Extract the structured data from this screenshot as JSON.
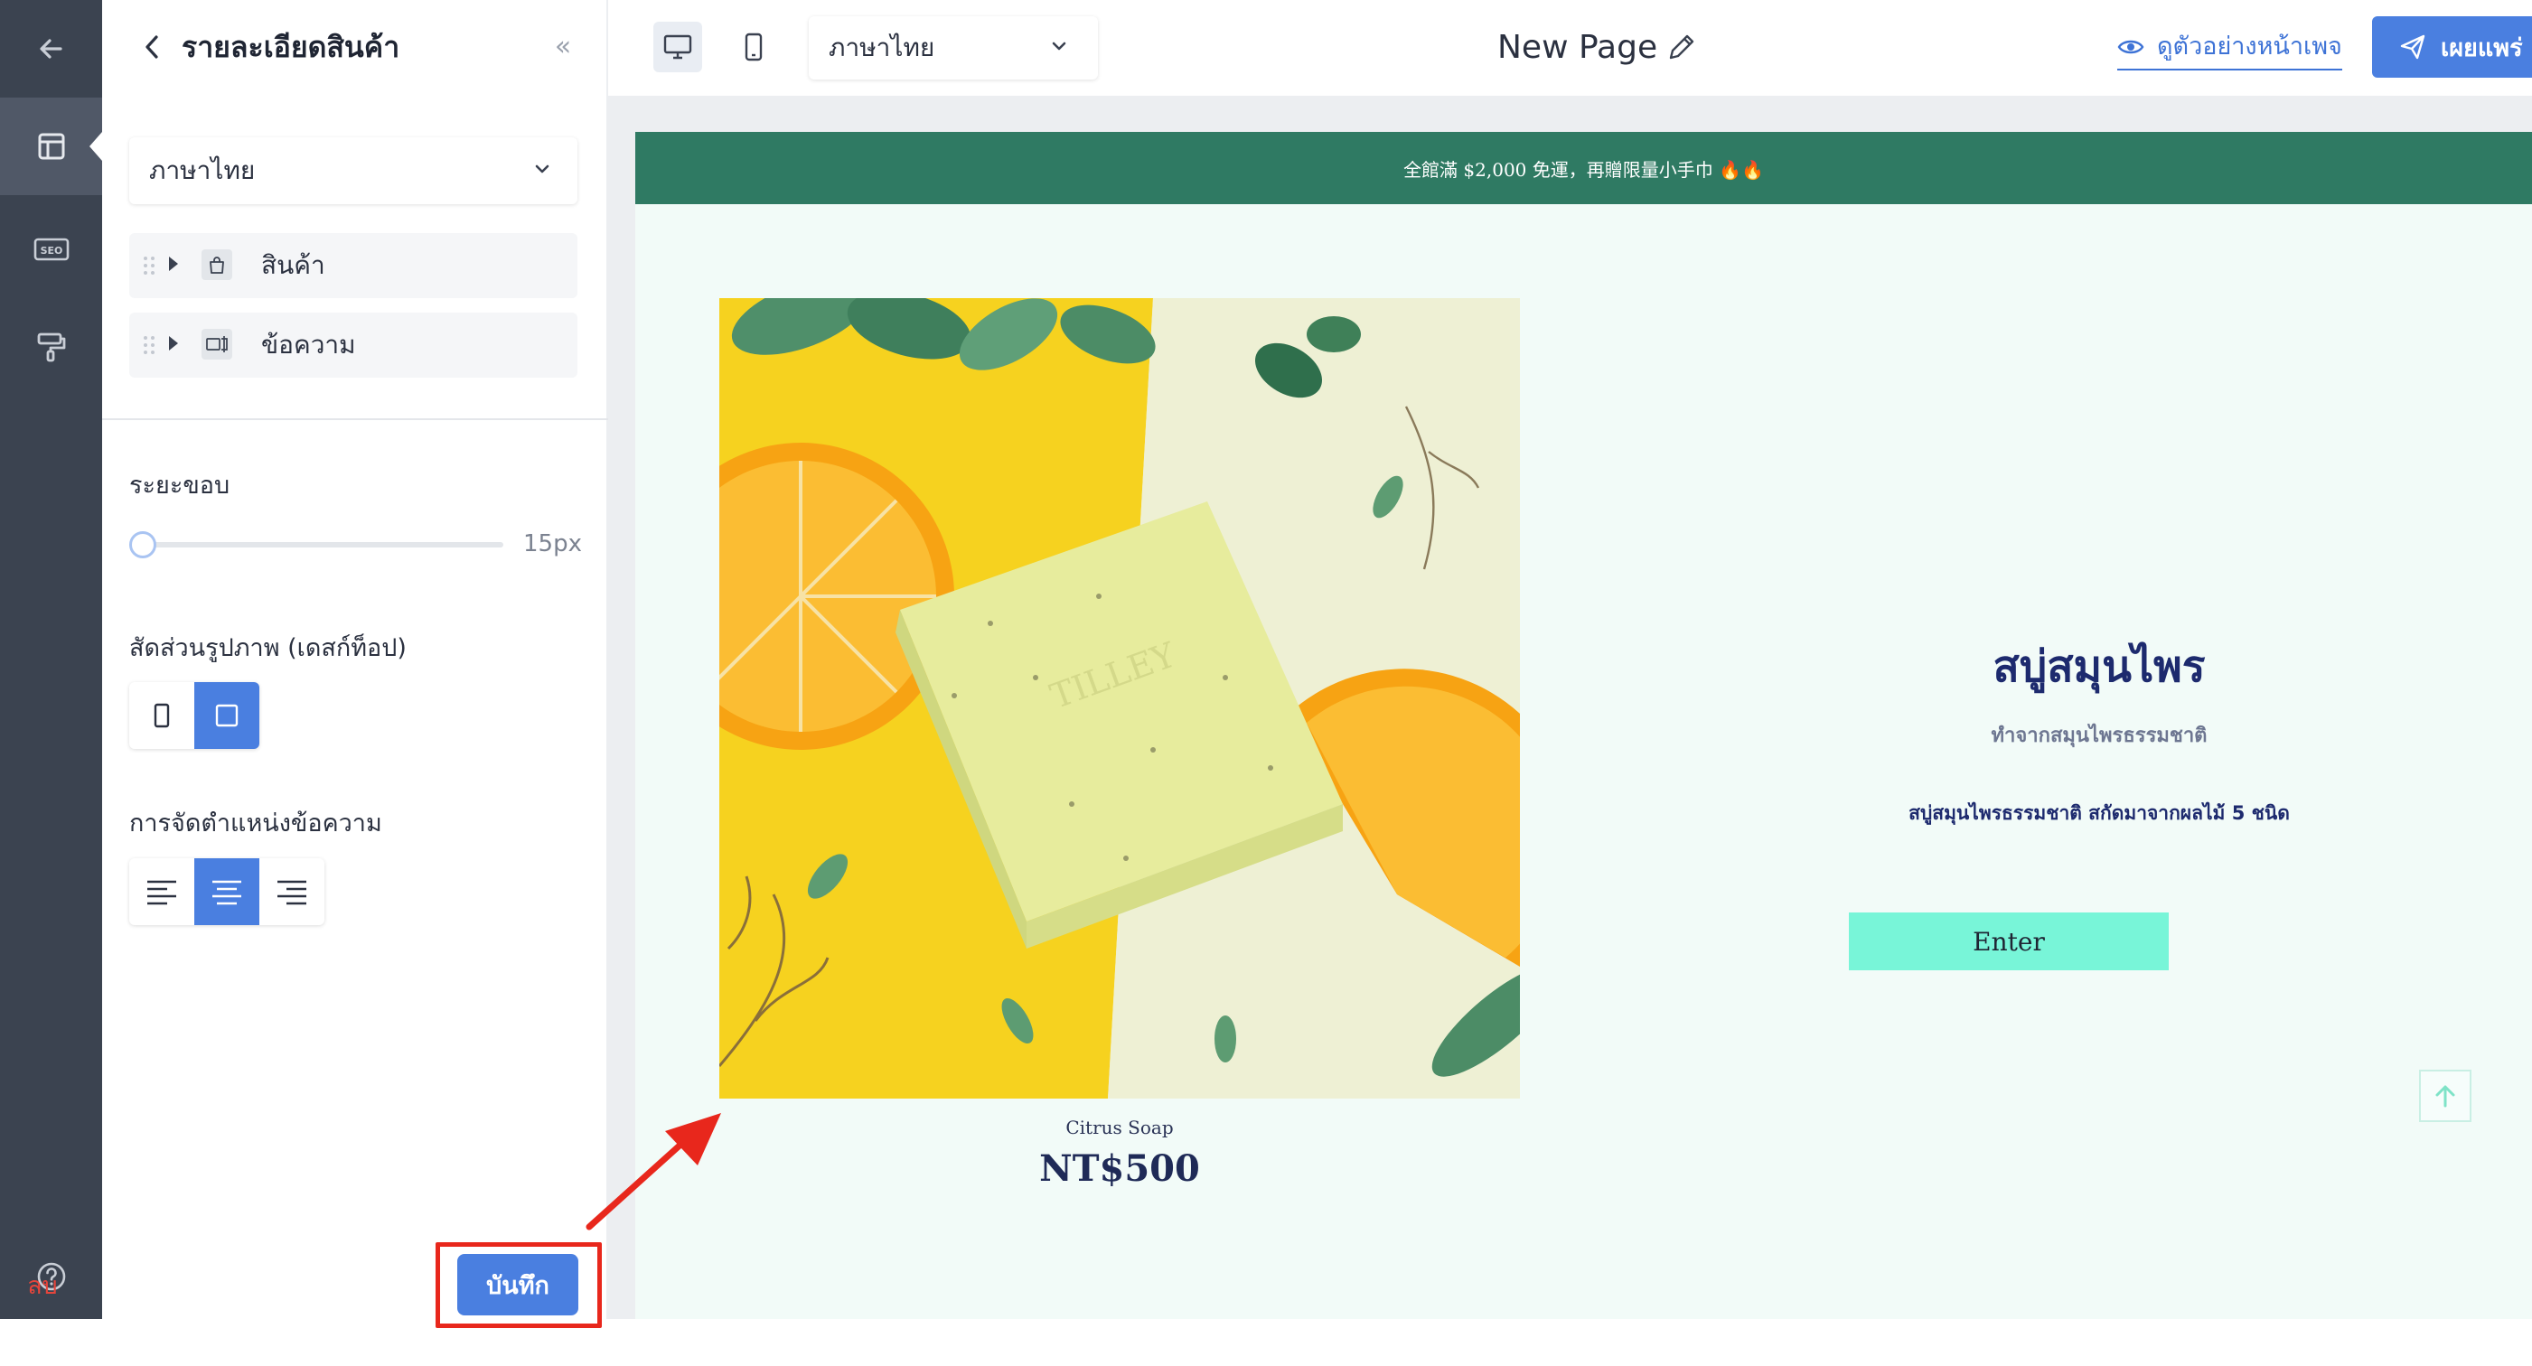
{
  "rail": {
    "items": [
      {
        "name": "back-arrow-icon"
      },
      {
        "name": "layout-icon",
        "active": true
      },
      {
        "name": "seo-icon",
        "text": "SEO"
      },
      {
        "name": "paint-roller-icon"
      },
      {
        "name": "help-icon"
      }
    ]
  },
  "panel": {
    "title": "รายละเอียดสินค้า",
    "collapse_glyph": "«",
    "language": "ภาษาไทย",
    "blocks": [
      {
        "label": "สินค้า",
        "icon": "bag-icon"
      },
      {
        "label": "ข้อความ",
        "icon": "text-box-icon"
      }
    ],
    "padding": {
      "label": "ระยะขอบ",
      "value": "15px",
      "fraction": 0.0
    },
    "aspect_ratio": {
      "label": "สัดส่วนรูปภาพ (เดสก์ท็อป)",
      "options": [
        "portrait",
        "square"
      ],
      "selected": "square"
    },
    "text_align": {
      "label": "การจัดตำแหน่งข้อความ",
      "options": [
        "left",
        "center",
        "right"
      ],
      "selected": "center"
    },
    "delete_label": "ลบ",
    "save_label": "บันทึก"
  },
  "topbar": {
    "devices": [
      "desktop",
      "mobile"
    ],
    "active_device": "desktop",
    "language": "ภาษาไทย",
    "page_name": "New Page",
    "preview_label": "ดูตัวอย่างหน้าเพจ",
    "publish_label": "เผยแพร่"
  },
  "site": {
    "announcement": "全館滿 $2,000 免運，再贈限量小手巾 🔥🔥",
    "product_caption": "Citrus Soap",
    "price": "NT$500",
    "heading": "สบู่สมุนไพร",
    "subheading": "ทำจากสมุนไพรธรรมชาติ",
    "description": "สบู่สมุนไพรธรรมชาติ สกัดมาจากผลไม้ 5 ชนิด",
    "button_label": "Enter",
    "logo_text": "TILLEY"
  },
  "colors": {
    "rail": "#3b4350",
    "accent": "#4a7fe0",
    "announce_bar": "#2f7a63",
    "site_bg": "#f2fbf8",
    "enter_button": "#78f5d8",
    "heading": "#1d2a6e",
    "delete": "#e6453b",
    "highlight": "#e8271c"
  }
}
